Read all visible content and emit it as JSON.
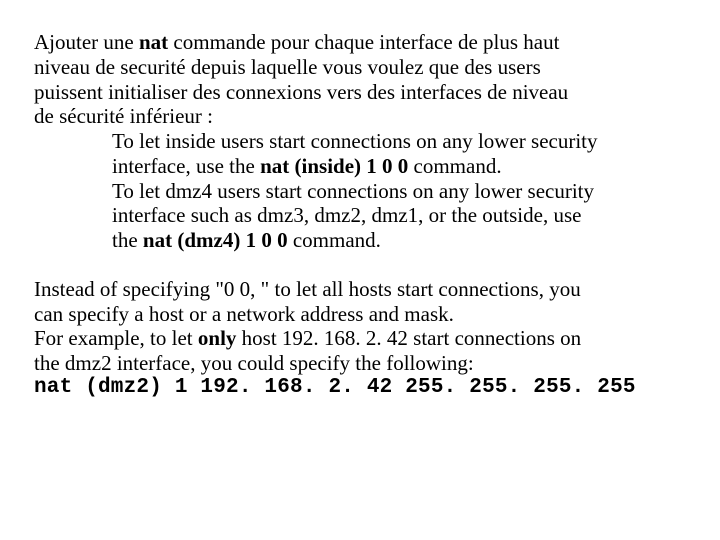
{
  "p1": {
    "l1a": "Ajouter une ",
    "l1b": "nat",
    "l1c": " commande pour chaque interface de plus haut",
    "l2": "niveau de securité depuis laquelle vous voulez que des users",
    "l3": "puissent initialiser des connexions vers des interfaces de niveau",
    "l4": "de sécurité inférieur :"
  },
  "ind": {
    "l1": "To let inside users start connections on any lower security",
    "l2a": "interface, use the ",
    "l2b": "nat (inside) 1 0 0",
    "l2c": " command.",
    "l3a": "To let dmz",
    "l3b": "4",
    "l3c": " users start connections on any lower security",
    "l4a": "interface such as dmz",
    "l4b": "3",
    "l4c": ", dmz",
    "l4d": "2",
    "l4e": ", dmz",
    "l4f": "1",
    "l4g": ", or the outside, use",
    "l5a": "the ",
    "l5b": "nat (dmz",
    "l5c": "4",
    "l5d": ") 1 0 0",
    "l5e": " command."
  },
  "p2": {
    "l1": "Instead of specifying \"0 0, \" to let all hosts start connections, you",
    "l2": "can specify a host or a network address and mask.",
    "l3a": "For example, to let ",
    "l3b": "only",
    "l3c": " host 192. 168. 2. 42 start connections on",
    "l4a": "the dmz",
    "l4b": "2",
    "l4c": " interface, you could specify the following:"
  },
  "cmd": "nat (dmz2) 1 192. 168. 2. 42 255. 255. 255. 255"
}
